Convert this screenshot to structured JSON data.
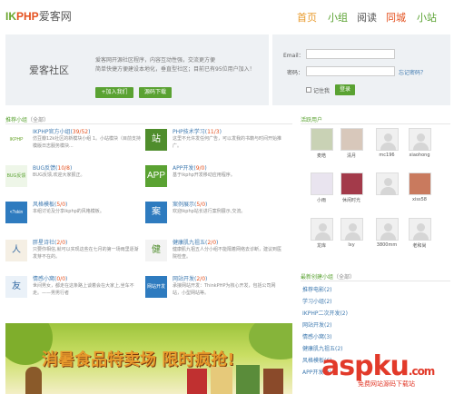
{
  "header": {
    "logo_en": "IKPHP",
    "logo_en_a": "IK",
    "logo_en_b": "PHP",
    "logo_cn": "爱客网",
    "nav": [
      "首页",
      "小组",
      "阅读",
      "同城",
      "小站"
    ],
    "nav_colors": [
      "#e89a2c",
      "#5aa232",
      "#555555",
      "#e4501e",
      "#5aa232"
    ]
  },
  "banner": {
    "title": "爱客社区",
    "desc1": "爱客网开源社区程序，内容互动性强，交流更方便",
    "desc2": "简单快捷方便建设本地化，垂直型社区；目前已有95位用户加入！",
    "join_label": "+加入我们",
    "download_label": "源码下载"
  },
  "login": {
    "email_label": "Email：",
    "password_label": "密码：",
    "forgot_label": "忘记密码？",
    "remember_label": "记住我",
    "login_label": "登录"
  },
  "groups": {
    "title": "推荐小组",
    "title_suffix": "（全部）",
    "items": [
      {
        "icon": "IKPHP",
        "icon_bg": "#ffffff",
        "icon_color": "#6aa52d",
        "name": "IKPHP官方小组",
        "count": "39/52",
        "desc": "仿豆瓣12k社区的新模块小组 1。小站模块（目前支持模版日志服务模块..."
      },
      {
        "icon": "站",
        "icon_bg": "#4f8d2c",
        "icon_color": "#ffffff",
        "name": "PHP技术学习",
        "count": "11/3",
        "desc": "这里不允许发任何广告，可以发我的书籍与时间开始推广。"
      },
      {
        "icon": "BUG反馈",
        "icon_bg": "#eef6e8",
        "icon_color": "#5aa232",
        "name": "BUG反馈",
        "count": "10/8",
        "desc": "BUG反馈,欢迎大家报正。"
      },
      {
        "icon": "APP",
        "icon_bg": "#5aa232",
        "icon_color": "#ffffff",
        "name": "APP开发",
        "count": "9/0",
        "desc": "基于ikphp开发移动应用程序。"
      },
      {
        "icon": "<?skin",
        "icon_bg": "#2e7bbf",
        "icon_color": "#ffffff",
        "name": "风格模板",
        "count": "5/0",
        "desc": "本组讨论及分享ikphp的风格模板。"
      },
      {
        "icon": "案",
        "icon_bg": "#2e7bbf",
        "icon_color": "#ffffff",
        "name": "案例展示",
        "count": "5/0",
        "desc": "欢迎ikphp站长进行案例展示,交流。"
      },
      {
        "icon": "人",
        "icon_bg": "#f5efe4",
        "icon_color": "#3a6ea5",
        "name": "胖星诗社",
        "count": "2/0",
        "desc": "只要你相信,就可以实现这些在七月的第一场雨里逐渐发芽不在的。"
      },
      {
        "icon": "健",
        "icon_bg": "#f3f3f3",
        "icon_color": "#4f8d2c",
        "name": "健康肌九祖五",
        "count": "2/0",
        "desc": "健康肌九祖五人分小组不能隔着网络去诊断，建议到医院检查。"
      },
      {
        "icon": "友",
        "icon_bg": "#eaf1f8",
        "icon_color": "#3a6ea5",
        "name": "情感小窝",
        "count": "0/0",
        "desc": "世间男女，都走在这条路上谈着会在大家上,坐车不走。——男男行者"
      },
      {
        "icon": "网站开发",
        "icon_bg": "#2e7bbf",
        "icon_color": "#ffffff",
        "name": "网站开发",
        "count": "2/0",
        "desc": "承接网站开发：ThinkPHP为核心开发，包括公司网站，小型网站等。"
      }
    ]
  },
  "ad": {
    "text": "消暑食品特卖场 限时疯抢!"
  },
  "active_users": {
    "title": "活跃用户",
    "items": [
      {
        "name": "麦皓",
        "bg": "#c9d2b5"
      },
      {
        "name": "清月",
        "bg": "#d8c8bb"
      },
      {
        "name": "mc196",
        "bg": "#f0f0f0"
      },
      {
        "name": "xiaohong",
        "bg": "#f0f0f0"
      },
      {
        "name": "小雨",
        "bg": "#e9e4ef"
      },
      {
        "name": "休闲时光",
        "bg": "#a33a4a"
      },
      {
        "name": "",
        "bg": "#f0f0f0"
      },
      {
        "name": "xiss58",
        "bg": "#c97a5e"
      },
      {
        "name": "龙库",
        "bg": "#f0f0f0"
      },
      {
        "name": "lxy",
        "bg": "#f0f0f0"
      },
      {
        "name": "3800mm",
        "bg": "#f0f0f0"
      },
      {
        "name": "老和尚",
        "bg": "#f0f0f0"
      }
    ]
  },
  "new_groups": {
    "title": "最新创建小组",
    "title_suffix": "（全部）",
    "items": [
      "推荐电影(2)",
      "学习小组(2)",
      "IKPHP二次开发(2)",
      "网站开发(2)",
      "情感小窝(3)",
      "健康肌九祖五(2)",
      "风格模板(6)",
      "APP开发(9)"
    ]
  },
  "watermark": {
    "brand": "aspku",
    "suffix": ".com",
    "sub": "免费网站源码下载站"
  }
}
